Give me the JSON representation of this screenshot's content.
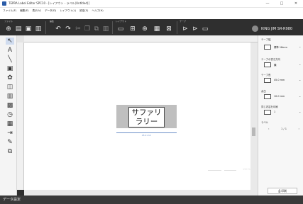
{
  "window": {
    "title": "TEPRA Label Editor SPC10 - [レイアウト - ラベル(Untitled)]",
    "minimize": "—",
    "maximize": "□",
    "close": "✕"
  },
  "menu": [
    "ファイル(F)",
    "編集(E)",
    "表示(V)",
    "データ(D)",
    "レイアウト(L)",
    "設定(S)",
    "ヘルプ(H)"
  ],
  "toolbar": {
    "groups": {
      "file": "ファイル",
      "edit": "編集",
      "layout": "レイアウト",
      "tape": "テープ"
    },
    "printer": "KING JIM SR-R980"
  },
  "canvas": {
    "label_text": "サファリ\nラリー",
    "dimension": "45.0 mm",
    "zoom": "150 %"
  },
  "panel": {
    "tape_width_head": "テープ幅",
    "tape_width_value": "標準 18mm",
    "tape_dir_head": "テープの書き方向",
    "tape_dir_value": "横",
    "tape_length_head": "テープ長",
    "tape_length_value": "45.0 mm",
    "margin_head": "余白",
    "margin_value": "10.0 mm",
    "copies_head": "同じ内容を印刷",
    "copies_value": "1",
    "label_head": "ラベル",
    "page": "1 / 1",
    "print": "印刷"
  },
  "bottom": {
    "text": "データ設定"
  }
}
